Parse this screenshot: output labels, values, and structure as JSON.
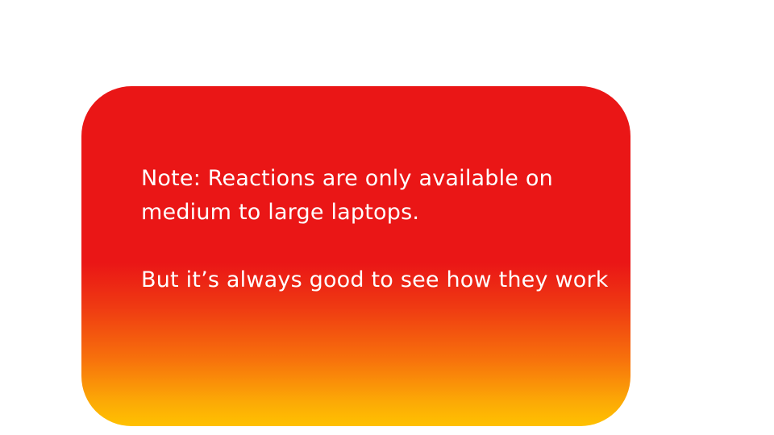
{
  "note": {
    "line1": "Note: Reactions are only available on medium to large laptops.",
    "line2": "But it’s always good to see how they work"
  },
  "colors": {
    "background": "#ffffff",
    "card_top": "#ea1616",
    "card_bottom": "#ffc100",
    "text": "#ffffff"
  }
}
